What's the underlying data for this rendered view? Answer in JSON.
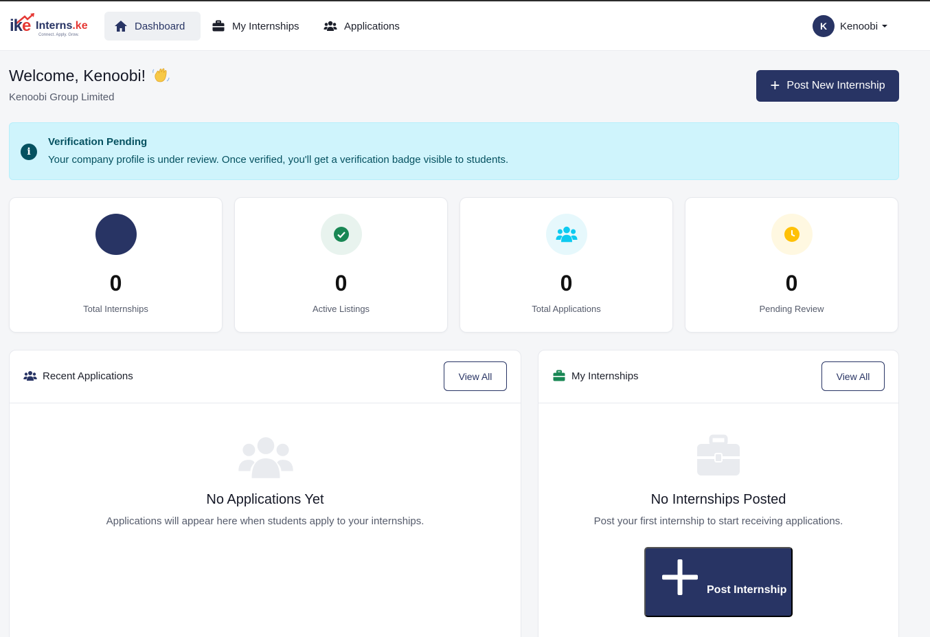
{
  "colors": {
    "brand": "#283464",
    "accent_red": "#e53935",
    "alert_bg": "#cff4fc",
    "alert_text": "#055160",
    "success": "#198754",
    "info": "#0dcaf0",
    "warning": "#ffc107"
  },
  "logo": {
    "mark": "ike",
    "name_main": "Interns",
    "name_suffix": ".ke",
    "tagline": "Connect. Apply. Grow."
  },
  "nav": {
    "items": [
      {
        "label": "Dashboard",
        "icon": "home-icon",
        "active": true
      },
      {
        "label": "My Internships",
        "icon": "briefcase-icon",
        "active": false
      },
      {
        "label": "Applications",
        "icon": "users-icon",
        "active": false
      }
    ]
  },
  "user": {
    "initial": "K",
    "name": "Kenoobi"
  },
  "header": {
    "welcome": "Welcome, Kenoobi!",
    "company": "Kenoobi Group Limited",
    "post_button": "Post New Internship"
  },
  "alert": {
    "title": "Verification Pending",
    "text": "Your company profile is under review. Once verified, you'll get a verification badge visible to students."
  },
  "stats": [
    {
      "value": "0",
      "label": "Total Internships",
      "icon": "briefcase-icon",
      "color": "#283464"
    },
    {
      "value": "0",
      "label": "Active Listings",
      "icon": "check-circle-icon",
      "color": "#198754"
    },
    {
      "value": "0",
      "label": "Total Applications",
      "icon": "users-icon",
      "color": "#0dcaf0"
    },
    {
      "value": "0",
      "label": "Pending Review",
      "icon": "clock-icon",
      "color": "#ffc107"
    }
  ],
  "recent_applications": {
    "title": "Recent Applications",
    "view_all": "View All",
    "empty_title": "No Applications Yet",
    "empty_text": "Applications will appear here when students apply to your internships."
  },
  "my_internships": {
    "title": "My Internships",
    "view_all": "View All",
    "empty_title": "No Internships Posted",
    "empty_text": "Post your first internship to start receiving applications.",
    "post_button": "Post Internship"
  }
}
